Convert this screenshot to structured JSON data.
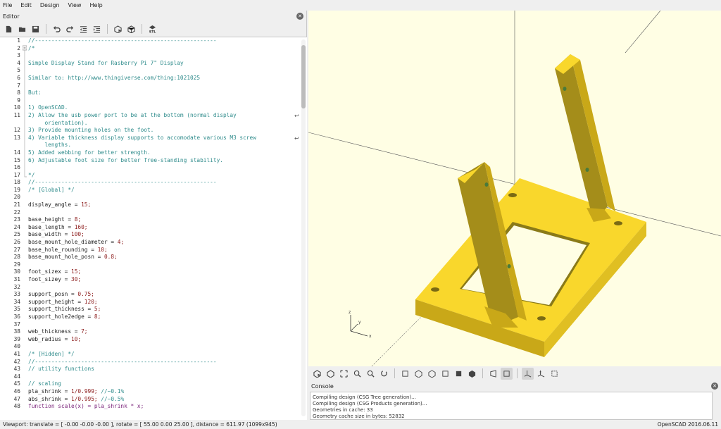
{
  "menu": [
    "File",
    "Edit",
    "Design",
    "View",
    "Help"
  ],
  "editor": {
    "title": "Editor"
  },
  "editor_toolbar": [
    "new-file-icon",
    "open-file-icon",
    "save-icon",
    "undo-icon",
    "redo-icon",
    "unindent-icon",
    "indent-icon",
    "preview-icon",
    "render-icon",
    "export-stl-icon"
  ],
  "code": {
    "line_numbers": [
      "1",
      "2",
      "3",
      "4",
      "5",
      "6",
      "7",
      "8",
      "9",
      "10",
      "11",
      "",
      "12",
      "13",
      "",
      "14",
      "15",
      "16",
      "17",
      "18",
      "19",
      "20",
      "21",
      "22",
      "23",
      "24",
      "25",
      "26",
      "27",
      "28",
      "29",
      "30",
      "31",
      "32",
      "33",
      "34",
      "35",
      "36",
      "37",
      "38",
      "39",
      "40",
      "41",
      "42",
      "43",
      "44",
      "45",
      "46",
      "47",
      "48"
    ],
    "lines": [
      "//-------------------------------------------------------",
      "/*",
      "",
      "Simple Display Stand for Rasberry Pi 7\" Display",
      "",
      "Similar to: http://www.thingiverse.com/thing:1021025",
      "",
      "But:",
      "",
      "1) OpenSCAD.",
      "2) Allow the usb power port to be at the bottom (normal display",
      "     orientation).",
      "3) Provide mounting holes on the foot.",
      "4) Variable thickness display supports to accomodate various M3 screw",
      "     lengths.",
      "5) Added webbing for better strength.",
      "6) Adjustable foot size for better free-standing stability.",
      "",
      "*/",
      "//-------------------------------------------------------",
      "/* [Global] */",
      "",
      "display_angle = 15;",
      "",
      "base_height = 8;",
      "base_length = 160;",
      "base_width = 100;",
      "base_mount_hole_diameter = 4;",
      "base_hole_rounding = 10;",
      "base_mount_hole_posn = 0.8;",
      "",
      "foot_sizex = 15;",
      "foot_sizey = 30;",
      "",
      "support_posn = 0.75;",
      "support_height = 120;",
      "support_thickness = 5;",
      "support_hole2edge = 8;",
      "",
      "web_thickness = 7;",
      "web_radius = 10;",
      "",
      "/* [Hidden] */",
      "//-------------------------------------------------------",
      "// utility functions",
      "",
      "// scaling",
      "pla_shrink = 1/0.999; //~0.1%",
      "abs_shrink = 1/0.995; //~0.5%",
      "function scale(x) = pla_shrink * x;"
    ]
  },
  "viewport_toolbar": [
    "preview-icon",
    "render-icon",
    "view-all-icon",
    "zoom-in-icon",
    "zoom-out-icon",
    "reset-view-icon",
    "view-right-icon",
    "view-top-icon",
    "view-bottom-icon",
    "view-left-icon",
    "view-front-icon",
    "view-back-icon",
    "perspective-icon",
    "orthogonal-icon",
    "show-axes-icon",
    "show-scale-icon",
    "show-edges-icon"
  ],
  "axes": {
    "x": "x",
    "y": "y",
    "z": "z"
  },
  "console": {
    "title": "Console",
    "messages": [
      "Compiling design (CSG Tree generation)...",
      "Compiling design (CSG Products generation)...",
      "Geometries in cache: 33",
      "Geometry cache size in bytes: 52832"
    ]
  },
  "status": {
    "viewport": "Viewport: translate = [ -0.00 -0.00 -0.00 ], rotate = [ 55.00 0.00 25.00 ], distance = 611.97 (1099x945)",
    "version": "OpenSCAD 2016.06.11"
  },
  "colors": {
    "model": "#f9d72c",
    "model_dark": "#7a6a14",
    "viewport_bg": "#fffee4",
    "comment": "#2e8b8b",
    "number": "#8b1a1a",
    "keyword": "#7a237a"
  }
}
